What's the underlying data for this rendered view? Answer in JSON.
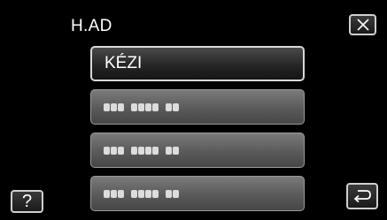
{
  "header": {
    "title": "H.AD"
  },
  "menu": {
    "items": [
      {
        "label": "KÉZI",
        "selected": true
      },
      {
        "label": "",
        "obscured": true
      },
      {
        "label": "",
        "obscured": true
      },
      {
        "label": "",
        "obscured": true
      }
    ]
  },
  "buttons": {
    "close_icon": "close-icon",
    "help_label": "?",
    "back_icon": "return-icon"
  },
  "colors": {
    "background": "#000000",
    "selected_item": "#262626",
    "unselected_item": "#5a5a5a",
    "border": "#d8d8d8",
    "text": "#ffffff"
  }
}
